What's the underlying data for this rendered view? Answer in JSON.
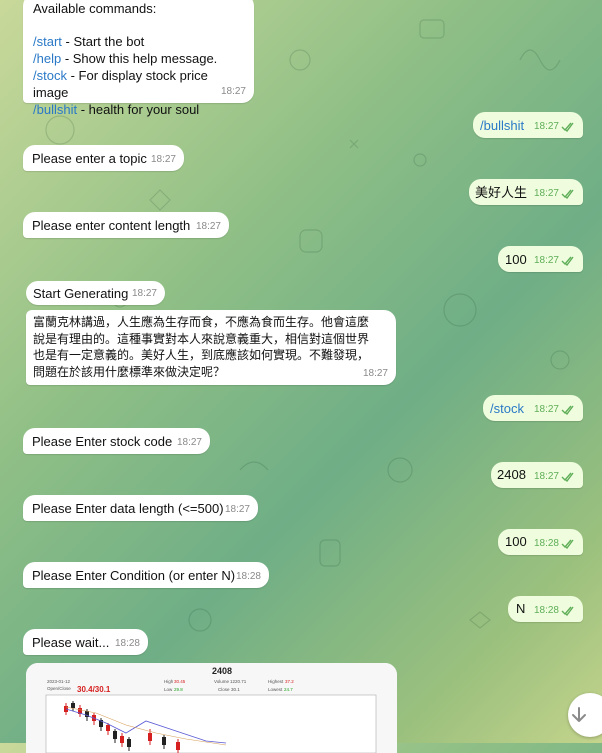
{
  "messages": {
    "help": {
      "header": "Available commands:",
      "items": [
        {
          "cmd": "/start",
          "desc": " - Start the bot"
        },
        {
          "cmd": "/help",
          "desc": " - Show this help message."
        },
        {
          "cmd": "/stock",
          "desc": " - For display stock price image"
        },
        {
          "cmd": "/bullshit",
          "desc": " - health for your soul"
        }
      ],
      "time": "18:27"
    },
    "out_bullshit": {
      "text": "/bullshit",
      "time": "18:27"
    },
    "topic_prompt": {
      "text": "Please enter a topic",
      "time": "18:27"
    },
    "out_topic": {
      "text": "美好人生",
      "time": "18:27"
    },
    "length_prompt": {
      "text": "Please enter content length",
      "time": "18:27"
    },
    "out_length": {
      "text": "100",
      "time": "18:27"
    },
    "start_gen": {
      "text": "Start Generating",
      "time": "18:27"
    },
    "generated": {
      "lines": [
        "富蘭克林講過，人生應為生存而食，不應為食而生存。他會這麼",
        "說是有理由的。這種事實對本人來說意義重大，相信對這個世界",
        "也是有一定意義的。美好人生，到底應該如何實現。不難發現，",
        "問題在於該用什麼標準來做決定呢？"
      ],
      "time": "18:27"
    },
    "out_stock": {
      "text": "/stock",
      "time": "18:27"
    },
    "code_prompt": {
      "text": "Please Enter stock code",
      "time": "18:27"
    },
    "out_code": {
      "text": "2408",
      "time": "18:27"
    },
    "datalen_prompt": {
      "text": "Please Enter data length (<=500)",
      "time": "18:27"
    },
    "out_datalen": {
      "text": "100",
      "time": "18:28"
    },
    "cond_prompt": {
      "text": "Please Enter Condition (or enter N)",
      "time": "18:28"
    },
    "out_cond": {
      "text": "N",
      "time": "18:28"
    },
    "wait": {
      "text": "Please wait...",
      "time": "18:28"
    }
  },
  "stock_image": {
    "title": "2408",
    "date": "2023-01-12",
    "open_close_label": "Open/Close",
    "open_close": "30.4/30.1",
    "high_label": "High",
    "high": "30.45",
    "low_label": "Low",
    "low": "29.8",
    "volume_label": "Volume",
    "volume": "1220.71",
    "highest_label": "Highest",
    "highest": "37.2",
    "lowest_label": "Lowest",
    "lowest": "24.7",
    "close_label": "Close",
    "close": "30.1"
  },
  "colors": {
    "incoming_bg": "#ffffff",
    "outgoing_bg": "#effdde",
    "command_link": "#2a79c7",
    "read_ticks": "#5fae58"
  },
  "icons": {
    "scroll_down": "arrow-down-icon",
    "read_receipt": "double-check-icon"
  }
}
